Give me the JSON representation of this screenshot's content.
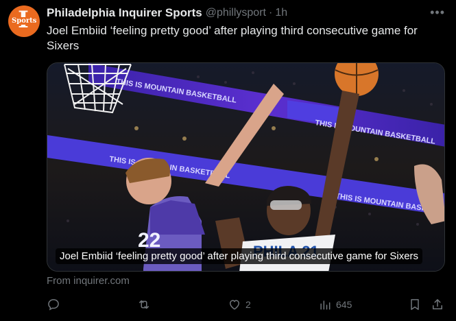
{
  "author": {
    "name": "Philadelphia Inquirer Sports",
    "handle": "@phillysport",
    "separator": "·",
    "time": "1h",
    "avatar_letter": "I",
    "avatar_word": "Sports"
  },
  "tweet": {
    "text": "Joel Embiid ‘feeling pretty good’ after playing third consecutive game for Sixers"
  },
  "card": {
    "caption": "Joel Embiid ‘feeling pretty good’ after playing third consecutive game for Sixers",
    "source": "From inquirer.com",
    "image_alt_elements": {
      "arena_banner_1": "THIS IS MOUNTAIN BASKETBALL",
      "arena_banner_2": "THIS IS MOUNTAIN BASKETBALL",
      "arena_banner_3": "THIS IS MOUNTAIN BASKETBALL",
      "arena_banner_4": "THIS IS MOUNTAIN BASKETBALL",
      "jersey_defender": "22",
      "jersey_shooter": "PHILA 21"
    }
  },
  "actions": {
    "reply_count": "",
    "retweet_count": "",
    "like_count": "2",
    "views_count": "645"
  },
  "colors": {
    "background": "#000000",
    "text_primary": "#e7e9ea",
    "text_secondary": "#71767b",
    "border": "#2f3336",
    "avatar_bg": "#ea6a1f",
    "banner_purple": "#5b2fd0"
  },
  "more_icon": "more-horizontal-icon"
}
